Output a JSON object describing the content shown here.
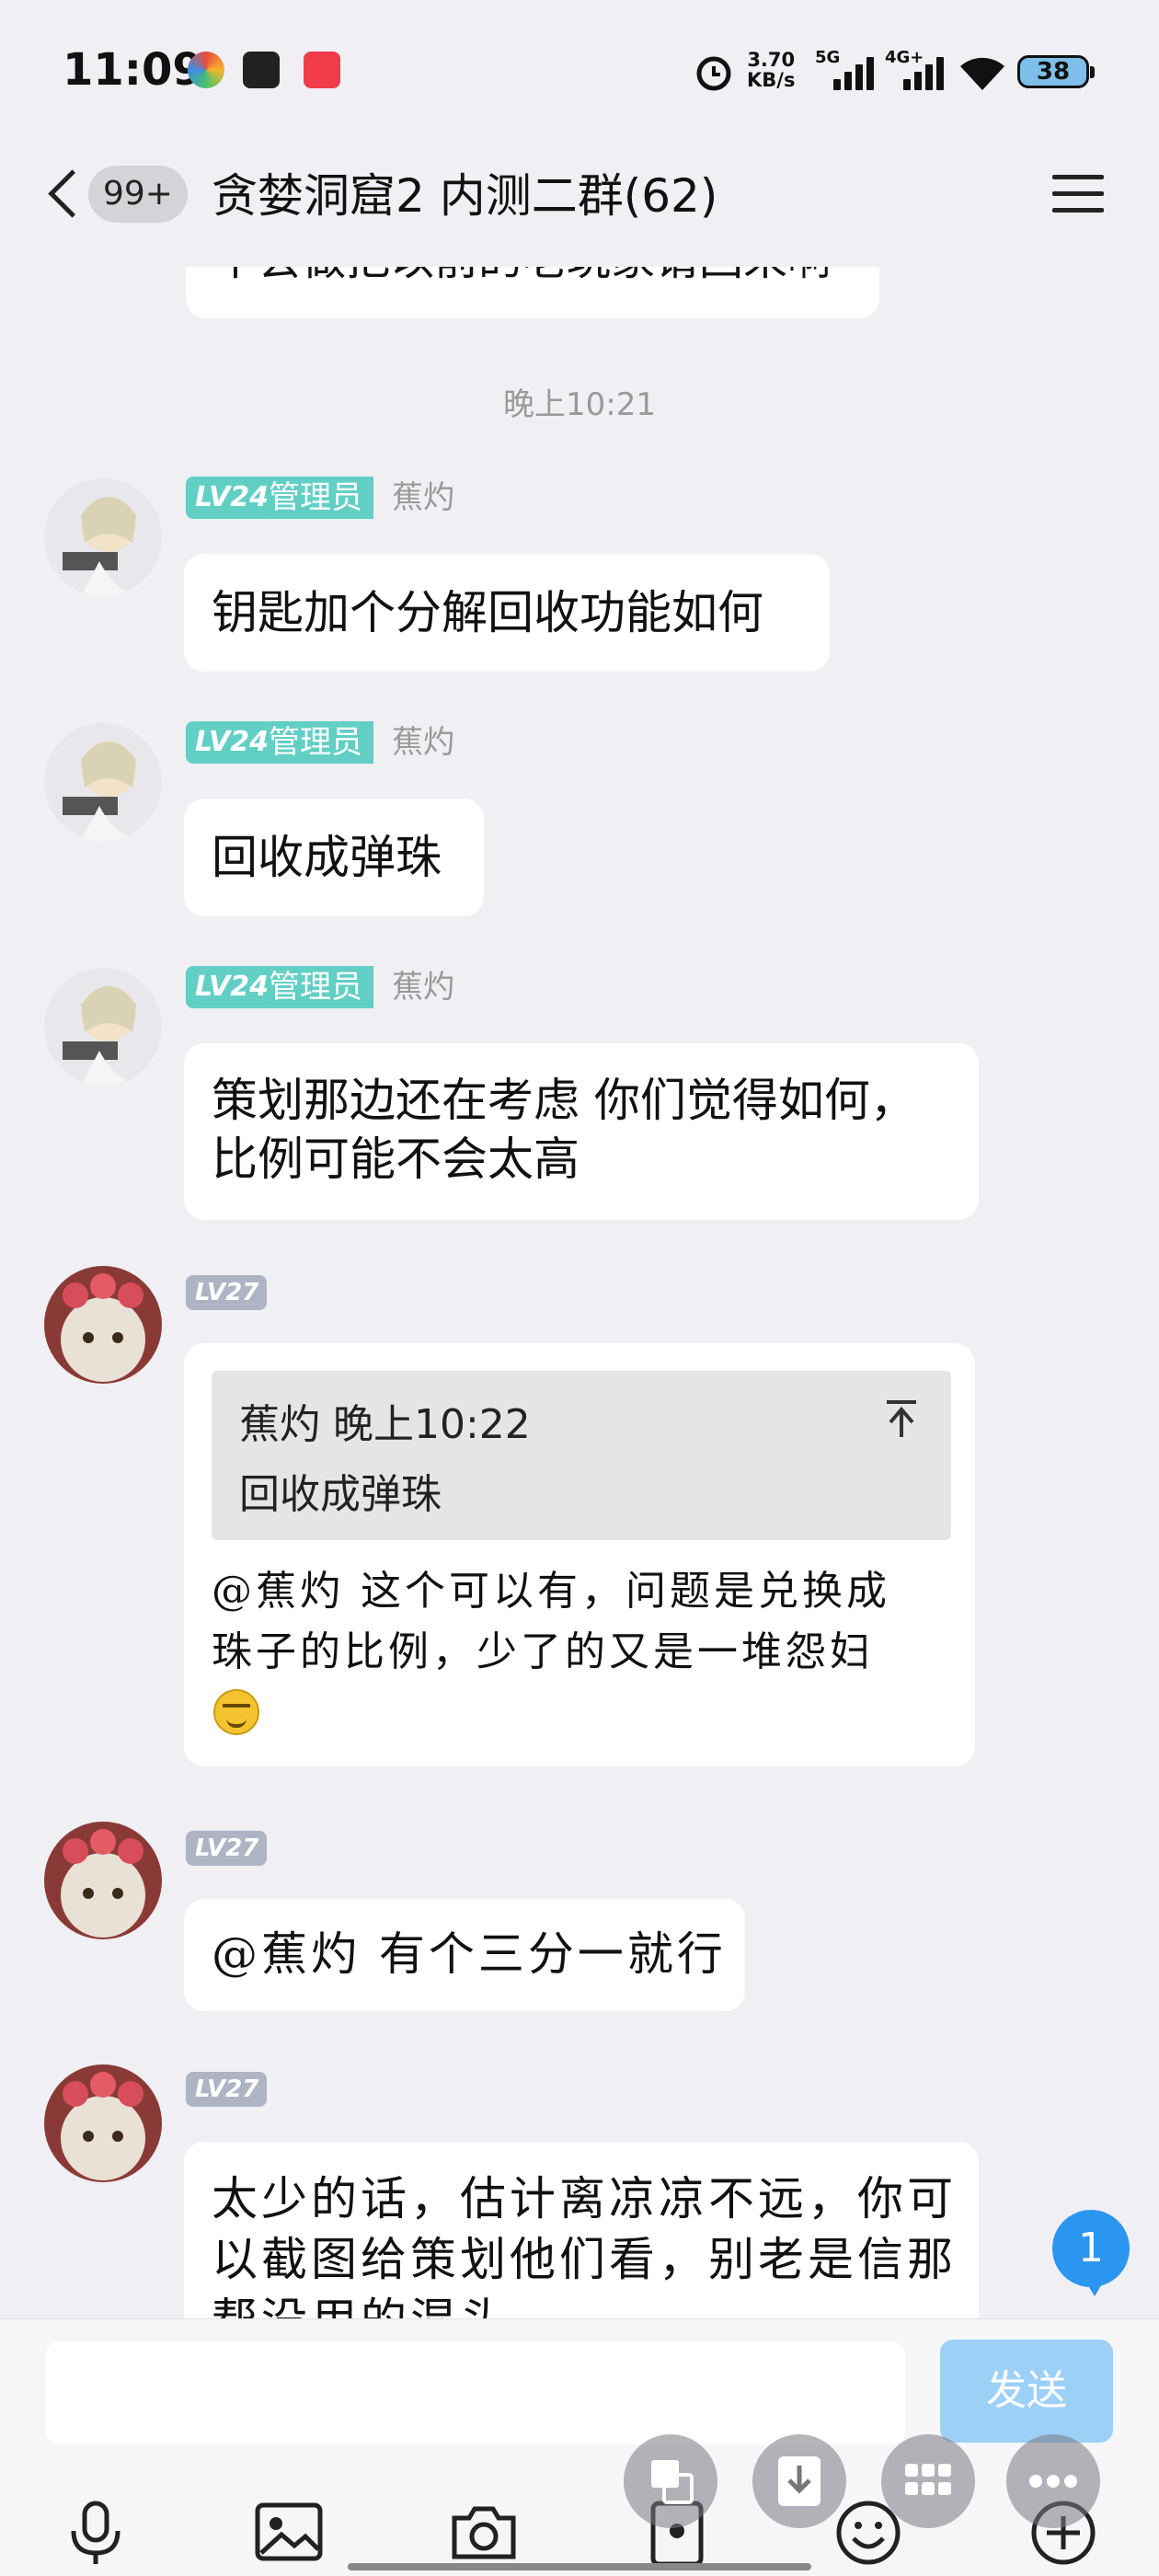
{
  "status_bar": {
    "time": "11:09",
    "net_speed_value": "3.70",
    "net_speed_unit": "KB/s",
    "sig1": "5G",
    "sig2": "4G+",
    "battery": "38",
    "app_icons": [
      "colorful-pinwheel-app",
      "bilibili-style-app",
      "red-app"
    ]
  },
  "header": {
    "unread": "99+",
    "title": "贪婪洞窟2 内测二群(62)",
    "back_icon": "chevron-left-icon",
    "menu_icon": "hamburger-menu-icon"
  },
  "chat": {
    "partial_prev_text": "不会做把以前的老玩家请回来啊",
    "timestamp": "晚上10:21",
    "messages": [
      {
        "level": "LV24",
        "role": "管理员",
        "sender": "蕉灼",
        "text": "钥匙加个分解回收功能如何"
      },
      {
        "level": "LV24",
        "role": "管理员",
        "sender": "蕉灼",
        "text": "回收成弹珠"
      },
      {
        "level": "LV24",
        "role": "管理员",
        "sender": "蕉灼",
        "line1": "策划那边还在考虑 你们觉得如何，",
        "line2": "比例可能不会太高"
      },
      {
        "level": "LV27",
        "quote_sender_time": "蕉灼 晚上10:22",
        "quote_text": "回收成弹珠",
        "line1": "@蕉灼 这个可以有，问题是兑换成",
        "line2": "珠子的比例，少了的又是一堆怨妇",
        "emoji": "grin-emoji"
      },
      {
        "level": "LV27",
        "text": "@蕉灼 有个三分一就行"
      },
      {
        "level": "LV27",
        "line1": "太少的话，估计离凉凉不远，你可",
        "line2": "以截图给策划他们看，别老是信那",
        "line3": "帮没用的混头"
      }
    ],
    "new_message_count": "1"
  },
  "input": {
    "placeholder": "",
    "send_label": "发送"
  },
  "toolbar": [
    "microphone-icon",
    "image-icon",
    "camera-icon",
    "red-packet-icon",
    "emoji-icon",
    "plus-icon"
  ],
  "floating": [
    "translate-icon",
    "download-icon",
    "grid-icon",
    "more-icon"
  ]
}
